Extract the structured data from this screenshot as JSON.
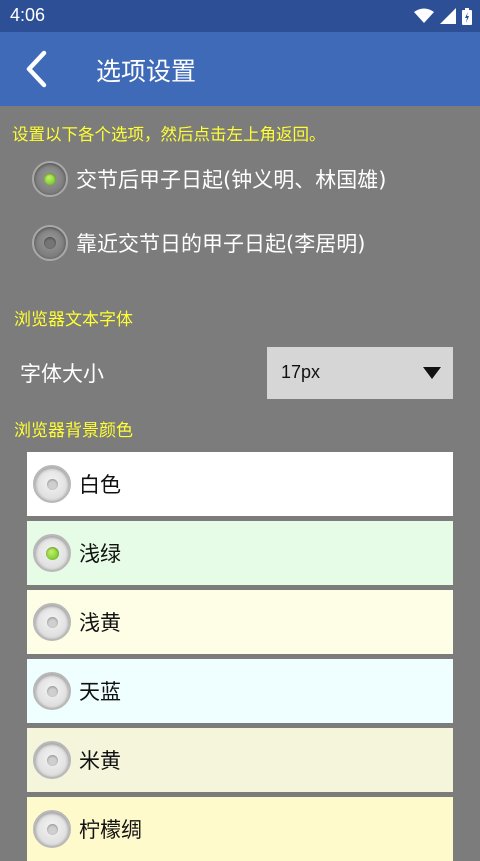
{
  "status_bar": {
    "time": "4:06",
    "icons": [
      "wifi-icon",
      "signal-icon",
      "battery-icon"
    ]
  },
  "app_bar": {
    "title": "选项设置",
    "back_icon": "chevron-left-icon"
  },
  "instruction": "设置以下各个选项，然后点击左上角返回。",
  "day_start_options": [
    {
      "label": "交节后甲子日起(钟义明、林国雄)",
      "checked": true
    },
    {
      "label": "靠近交节日的甲子日起(李居明)",
      "checked": false
    }
  ],
  "font_section": {
    "title": "浏览器文本字体",
    "size_label": "字体大小",
    "size_value": "17px"
  },
  "bg_section": {
    "title": "浏览器背景颜色",
    "options": [
      {
        "label": "白色",
        "color": "#ffffff",
        "checked": false
      },
      {
        "label": "浅绿",
        "color": "#e6fce6",
        "checked": true
      },
      {
        "label": "浅黄",
        "color": "#fefee6",
        "checked": false
      },
      {
        "label": "天蓝",
        "color": "#effefe",
        "checked": false
      },
      {
        "label": "米黄",
        "color": "#f5f5dc",
        "checked": false
      },
      {
        "label": "柠檬绸",
        "color": "#fffacc",
        "checked": false
      }
    ]
  },
  "colors": {
    "status_bar": "#2d4f96",
    "app_bar": "#3f6ab8",
    "background": "#7c7c7c",
    "accent_text": "#ffff33"
  }
}
